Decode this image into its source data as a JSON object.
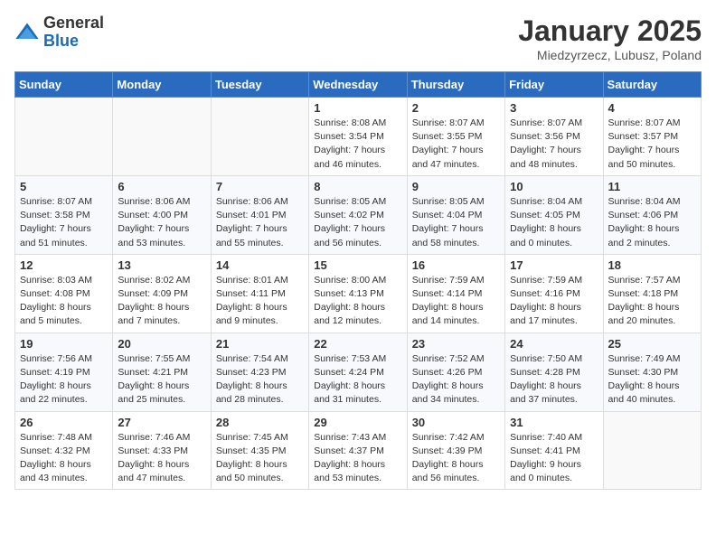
{
  "logo": {
    "general": "General",
    "blue": "Blue"
  },
  "header": {
    "title": "January 2025",
    "subtitle": "Miedzyrzecz, Lubusz, Poland"
  },
  "days_of_week": [
    "Sunday",
    "Monday",
    "Tuesday",
    "Wednesday",
    "Thursday",
    "Friday",
    "Saturday"
  ],
  "weeks": [
    [
      {
        "num": "",
        "info": ""
      },
      {
        "num": "",
        "info": ""
      },
      {
        "num": "",
        "info": ""
      },
      {
        "num": "1",
        "info": "Sunrise: 8:08 AM\nSunset: 3:54 PM\nDaylight: 7 hours and 46 minutes."
      },
      {
        "num": "2",
        "info": "Sunrise: 8:07 AM\nSunset: 3:55 PM\nDaylight: 7 hours and 47 minutes."
      },
      {
        "num": "3",
        "info": "Sunrise: 8:07 AM\nSunset: 3:56 PM\nDaylight: 7 hours and 48 minutes."
      },
      {
        "num": "4",
        "info": "Sunrise: 8:07 AM\nSunset: 3:57 PM\nDaylight: 7 hours and 50 minutes."
      }
    ],
    [
      {
        "num": "5",
        "info": "Sunrise: 8:07 AM\nSunset: 3:58 PM\nDaylight: 7 hours and 51 minutes."
      },
      {
        "num": "6",
        "info": "Sunrise: 8:06 AM\nSunset: 4:00 PM\nDaylight: 7 hours and 53 minutes."
      },
      {
        "num": "7",
        "info": "Sunrise: 8:06 AM\nSunset: 4:01 PM\nDaylight: 7 hours and 55 minutes."
      },
      {
        "num": "8",
        "info": "Sunrise: 8:05 AM\nSunset: 4:02 PM\nDaylight: 7 hours and 56 minutes."
      },
      {
        "num": "9",
        "info": "Sunrise: 8:05 AM\nSunset: 4:04 PM\nDaylight: 7 hours and 58 minutes."
      },
      {
        "num": "10",
        "info": "Sunrise: 8:04 AM\nSunset: 4:05 PM\nDaylight: 8 hours and 0 minutes."
      },
      {
        "num": "11",
        "info": "Sunrise: 8:04 AM\nSunset: 4:06 PM\nDaylight: 8 hours and 2 minutes."
      }
    ],
    [
      {
        "num": "12",
        "info": "Sunrise: 8:03 AM\nSunset: 4:08 PM\nDaylight: 8 hours and 5 minutes."
      },
      {
        "num": "13",
        "info": "Sunrise: 8:02 AM\nSunset: 4:09 PM\nDaylight: 8 hours and 7 minutes."
      },
      {
        "num": "14",
        "info": "Sunrise: 8:01 AM\nSunset: 4:11 PM\nDaylight: 8 hours and 9 minutes."
      },
      {
        "num": "15",
        "info": "Sunrise: 8:00 AM\nSunset: 4:13 PM\nDaylight: 8 hours and 12 minutes."
      },
      {
        "num": "16",
        "info": "Sunrise: 7:59 AM\nSunset: 4:14 PM\nDaylight: 8 hours and 14 minutes."
      },
      {
        "num": "17",
        "info": "Sunrise: 7:59 AM\nSunset: 4:16 PM\nDaylight: 8 hours and 17 minutes."
      },
      {
        "num": "18",
        "info": "Sunrise: 7:57 AM\nSunset: 4:18 PM\nDaylight: 8 hours and 20 minutes."
      }
    ],
    [
      {
        "num": "19",
        "info": "Sunrise: 7:56 AM\nSunset: 4:19 PM\nDaylight: 8 hours and 22 minutes."
      },
      {
        "num": "20",
        "info": "Sunrise: 7:55 AM\nSunset: 4:21 PM\nDaylight: 8 hours and 25 minutes."
      },
      {
        "num": "21",
        "info": "Sunrise: 7:54 AM\nSunset: 4:23 PM\nDaylight: 8 hours and 28 minutes."
      },
      {
        "num": "22",
        "info": "Sunrise: 7:53 AM\nSunset: 4:24 PM\nDaylight: 8 hours and 31 minutes."
      },
      {
        "num": "23",
        "info": "Sunrise: 7:52 AM\nSunset: 4:26 PM\nDaylight: 8 hours and 34 minutes."
      },
      {
        "num": "24",
        "info": "Sunrise: 7:50 AM\nSunset: 4:28 PM\nDaylight: 8 hours and 37 minutes."
      },
      {
        "num": "25",
        "info": "Sunrise: 7:49 AM\nSunset: 4:30 PM\nDaylight: 8 hours and 40 minutes."
      }
    ],
    [
      {
        "num": "26",
        "info": "Sunrise: 7:48 AM\nSunset: 4:32 PM\nDaylight: 8 hours and 43 minutes."
      },
      {
        "num": "27",
        "info": "Sunrise: 7:46 AM\nSunset: 4:33 PM\nDaylight: 8 hours and 47 minutes."
      },
      {
        "num": "28",
        "info": "Sunrise: 7:45 AM\nSunset: 4:35 PM\nDaylight: 8 hours and 50 minutes."
      },
      {
        "num": "29",
        "info": "Sunrise: 7:43 AM\nSunset: 4:37 PM\nDaylight: 8 hours and 53 minutes."
      },
      {
        "num": "30",
        "info": "Sunrise: 7:42 AM\nSunset: 4:39 PM\nDaylight: 8 hours and 56 minutes."
      },
      {
        "num": "31",
        "info": "Sunrise: 7:40 AM\nSunset: 4:41 PM\nDaylight: 9 hours and 0 minutes."
      },
      {
        "num": "",
        "info": ""
      }
    ]
  ]
}
